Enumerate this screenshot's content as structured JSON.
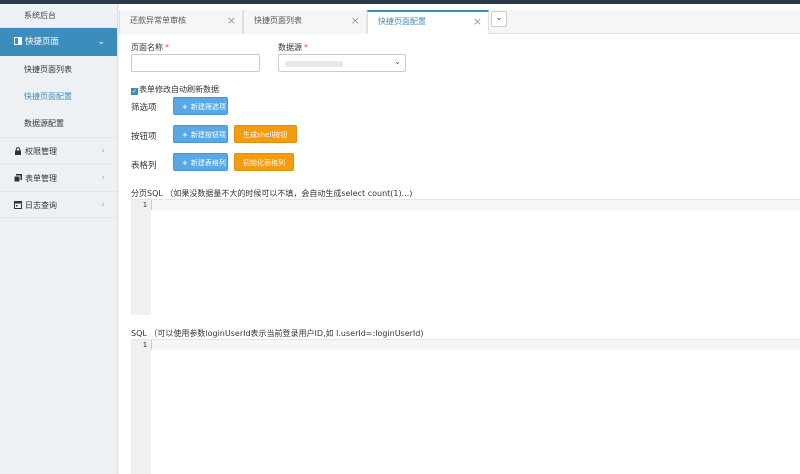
{
  "sidebar": {
    "title": "系统后台",
    "active_group": "快捷页面",
    "sub_items": [
      "快捷页面列表",
      "快捷页面配置",
      "数据源配置"
    ],
    "active_sub_index": 1,
    "groups": [
      "权限管理",
      "表单管理",
      "日志查询"
    ]
  },
  "tabs": [
    {
      "label": "还款异常单审核"
    },
    {
      "label": "快捷页面列表"
    },
    {
      "label": "快捷页面配置",
      "active": true
    }
  ],
  "tab_more_icon": "chevron-down-icon",
  "form": {
    "page_name_label": "页面名称",
    "page_name_value": "",
    "datasource_label": "数据源",
    "datasource_value": "",
    "required_mark": "*",
    "auto_refresh_label": "表单修改自动刷新数据",
    "auto_refresh_checked": true,
    "filter_label": "筛选项",
    "add_filter_btn": "新建筛选项",
    "button_label": "按钮项",
    "add_button_btn": "新建按钮项",
    "gen_shell_btn": "生成shell按钮",
    "table_col_label": "表格列",
    "add_col_btn": "新建表格列",
    "init_cols_btn": "初始化表格列"
  },
  "paging_sql": {
    "label": "分页SQL",
    "hint": "（如果没数据量不大的时候可以不填，会自动生成select count(1)...)",
    "line_number": "1"
  },
  "sql": {
    "label": "SQL",
    "hint": "（可以使用参数loginUserId表示当前登录用户ID,如 l.userId=:loginUserId)",
    "line_number": "1"
  },
  "colors": {
    "accent": "#3c8dbc",
    "blue_button": "#5aa9e6",
    "orange_button": "#f39c12"
  }
}
